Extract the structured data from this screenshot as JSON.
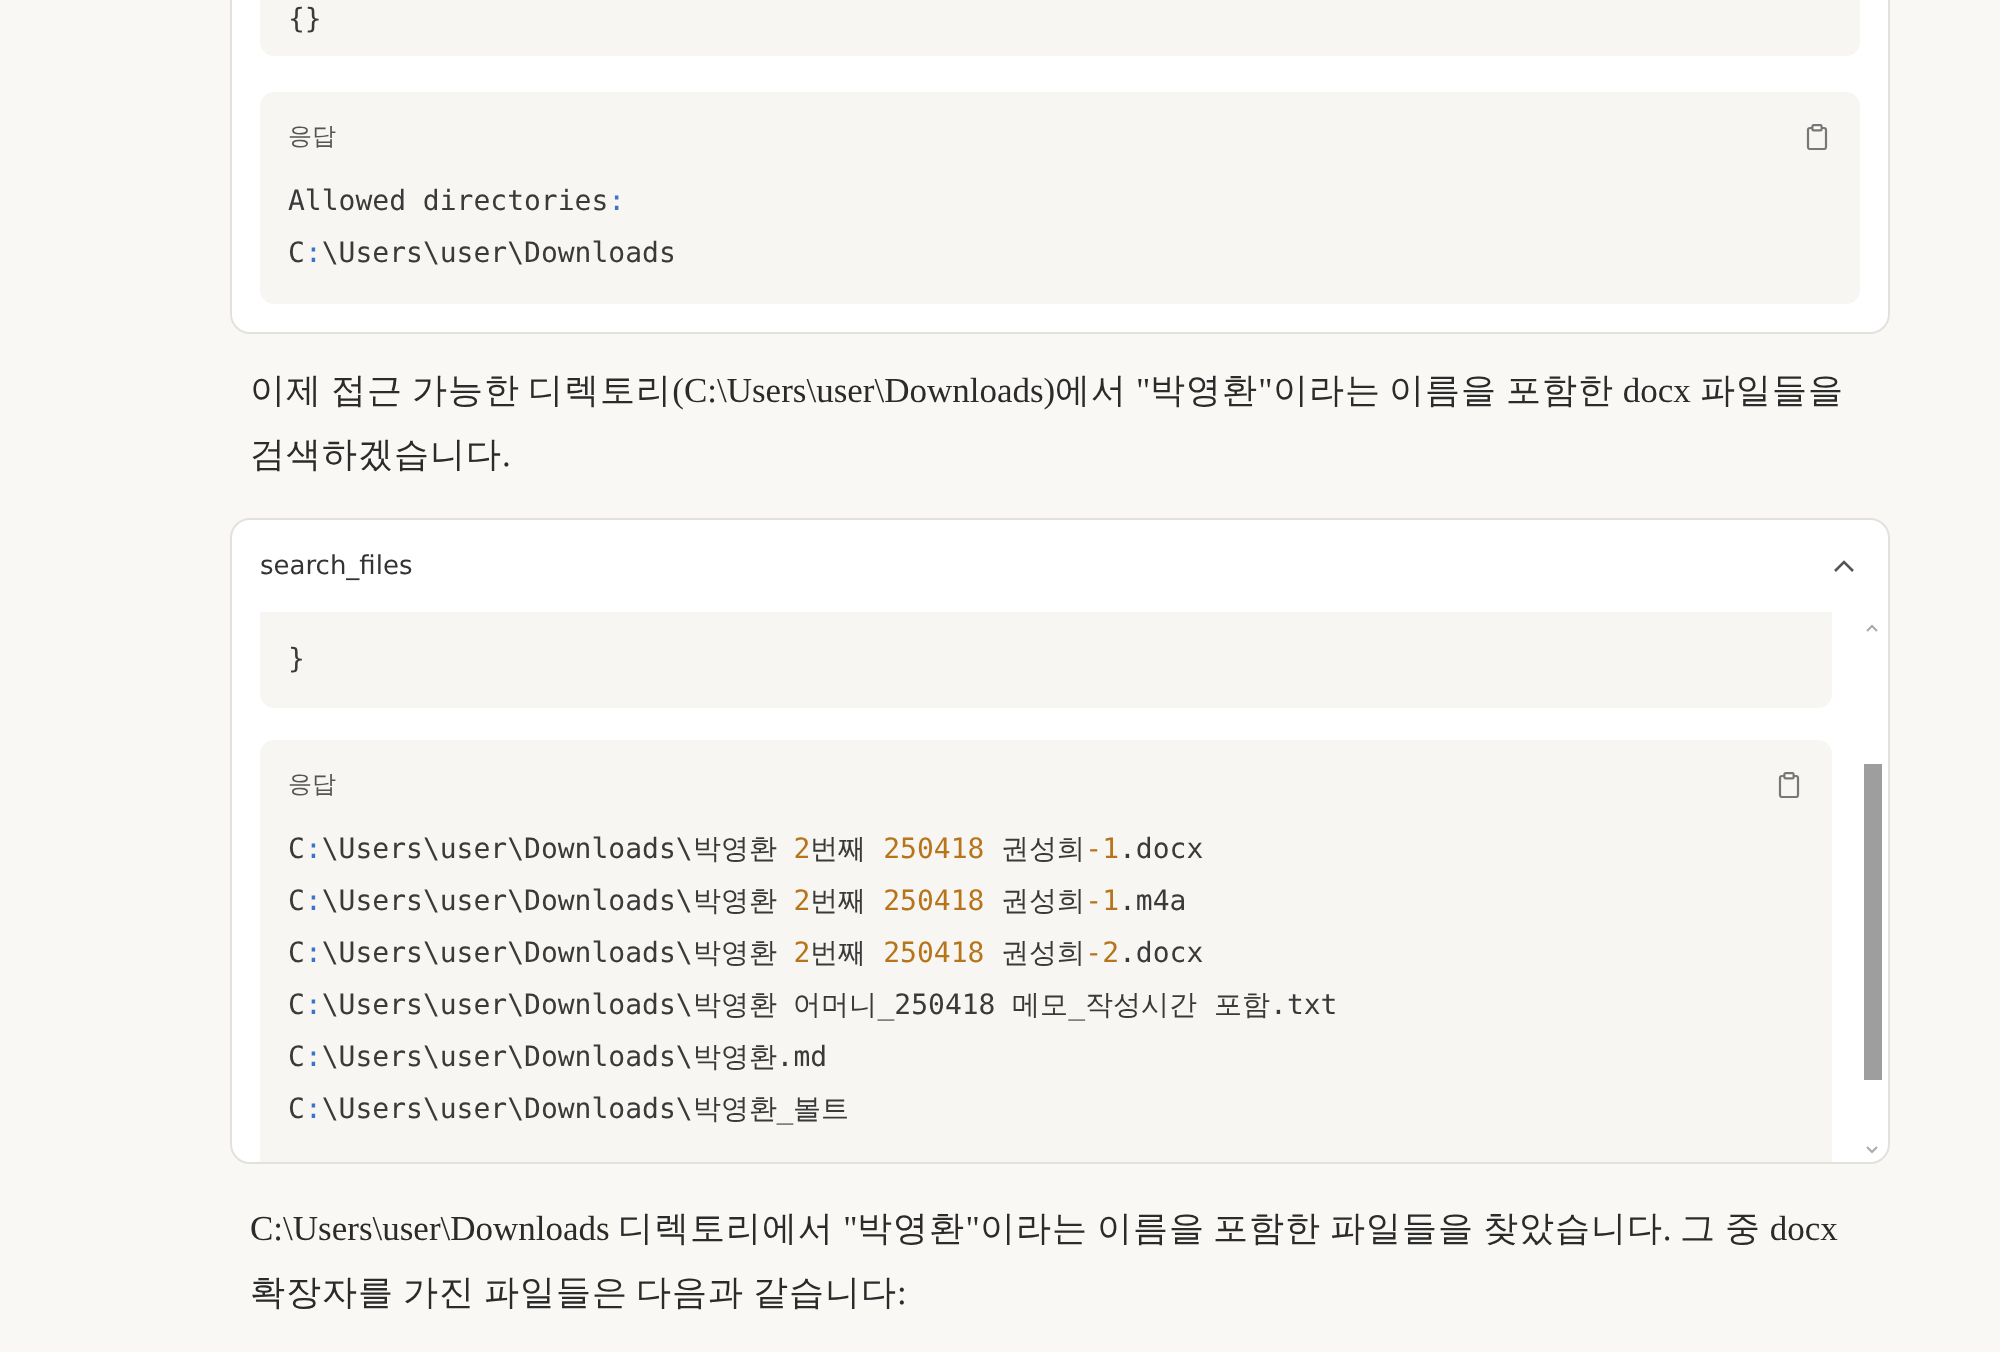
{
  "top_card": {
    "request_code": "{}",
    "response": {
      "label": "응답",
      "lines": [
        [
          {
            "text": "Allowed directories",
            "kind": "plain"
          },
          {
            "text": ":",
            "kind": "punct"
          }
        ],
        [
          {
            "text": "C",
            "kind": "plain"
          },
          {
            "text": ":",
            "kind": "punct"
          },
          {
            "text": "\\Users\\user\\Downloads",
            "kind": "plain"
          }
        ]
      ]
    }
  },
  "message_1": "이제 접근 가능한 디렉토리(C:\\Users\\user\\Downloads)에서 \"박영환\"이라는 이름을 포함한 docx 파일들을 검색하겠습니다.",
  "tool_card": {
    "title": "search_files",
    "expanded": true,
    "request_code": "}",
    "response": {
      "label": "응답",
      "lines": [
        [
          {
            "text": "C",
            "kind": "plain"
          },
          {
            "text": ":",
            "kind": "punct"
          },
          {
            "text": "\\Users\\user\\Downloads\\박영환 ",
            "kind": "plain"
          },
          {
            "text": "2",
            "kind": "num"
          },
          {
            "text": "번째 ",
            "kind": "plain"
          },
          {
            "text": "250418",
            "kind": "num"
          },
          {
            "text": " 권성희",
            "kind": "plain"
          },
          {
            "text": "-1",
            "kind": "num"
          },
          {
            "text": ".docx",
            "kind": "plain"
          }
        ],
        [
          {
            "text": "C",
            "kind": "plain"
          },
          {
            "text": ":",
            "kind": "punct"
          },
          {
            "text": "\\Users\\user\\Downloads\\박영환 ",
            "kind": "plain"
          },
          {
            "text": "2",
            "kind": "num"
          },
          {
            "text": "번째 ",
            "kind": "plain"
          },
          {
            "text": "250418",
            "kind": "num"
          },
          {
            "text": " 권성희",
            "kind": "plain"
          },
          {
            "text": "-1",
            "kind": "num"
          },
          {
            "text": ".m4a",
            "kind": "plain"
          }
        ],
        [
          {
            "text": "C",
            "kind": "plain"
          },
          {
            "text": ":",
            "kind": "punct"
          },
          {
            "text": "\\Users\\user\\Downloads\\박영환 ",
            "kind": "plain"
          },
          {
            "text": "2",
            "kind": "num"
          },
          {
            "text": "번째 ",
            "kind": "plain"
          },
          {
            "text": "250418",
            "kind": "num"
          },
          {
            "text": " 권성희",
            "kind": "plain"
          },
          {
            "text": "-2",
            "kind": "num"
          },
          {
            "text": ".docx",
            "kind": "plain"
          }
        ],
        [
          {
            "text": "C",
            "kind": "plain"
          },
          {
            "text": ":",
            "kind": "punct"
          },
          {
            "text": "\\Users\\user\\Downloads\\박영환 어머니_250418 메모_작성시간 포함.txt",
            "kind": "plain"
          }
        ],
        [
          {
            "text": "C",
            "kind": "plain"
          },
          {
            "text": ":",
            "kind": "punct"
          },
          {
            "text": "\\Users\\user\\Downloads\\박영환.md",
            "kind": "plain"
          }
        ],
        [
          {
            "text": "C",
            "kind": "plain"
          },
          {
            "text": ":",
            "kind": "punct"
          },
          {
            "text": "\\Users\\user\\Downloads\\박영환_볼트",
            "kind": "plain"
          }
        ]
      ]
    }
  },
  "message_2": "C:\\Users\\user\\Downloads 디렉토리에서 \"박영환\"이라는 이름을 포함한 파일들을 찾았습니다. 그 중 docx 확장자를 가진 파일들은 다음과 같습니다:"
}
